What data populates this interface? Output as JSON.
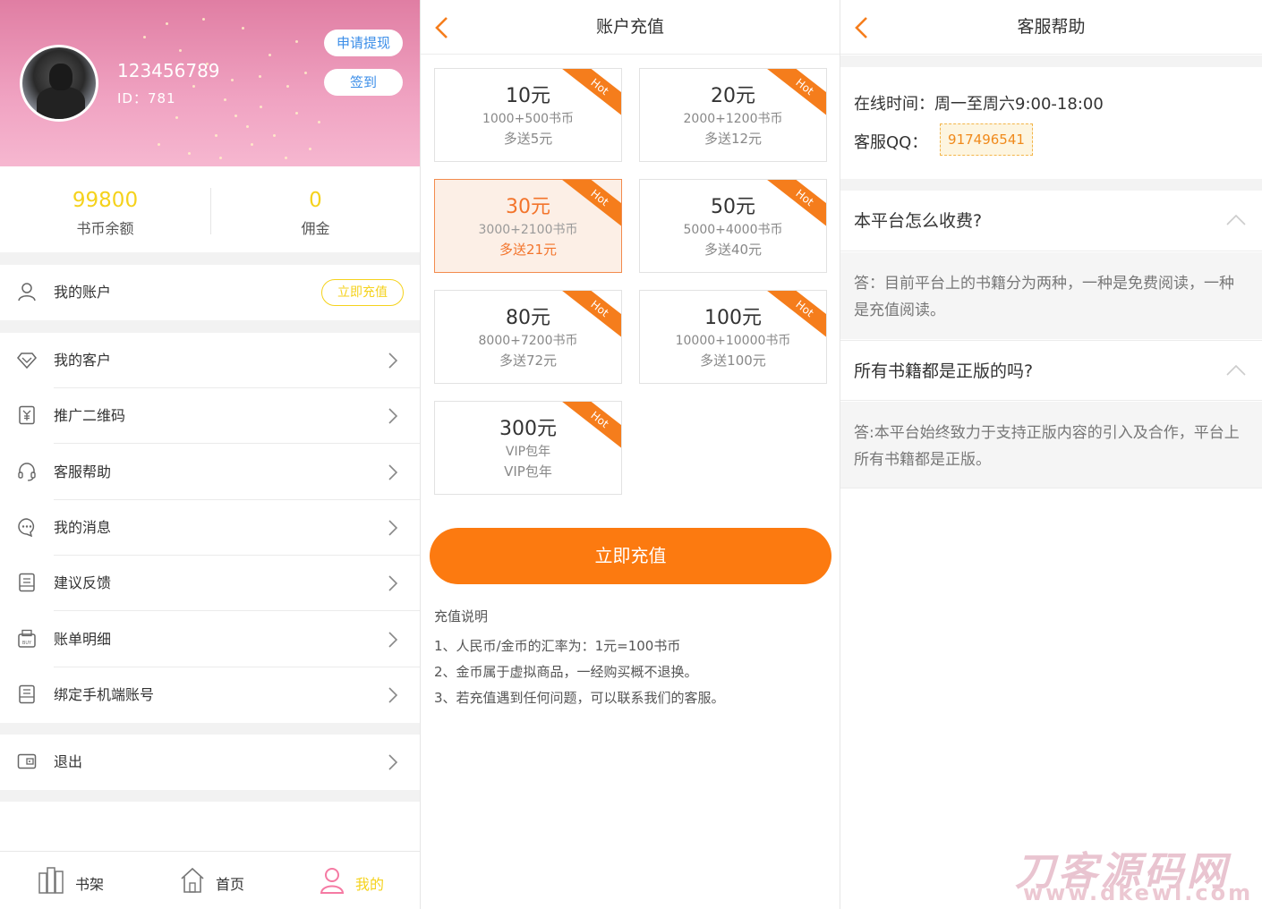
{
  "profile": {
    "username": "123456789",
    "id_text": "ID：781",
    "withdraw_label": "申请提现",
    "checkin_label": "签到",
    "balance_value": "99800",
    "balance_label": "书币余额",
    "commission_value": "0",
    "commission_label": "佣金",
    "accent_color": "#f5d21c",
    "hero_color": "#e07ea3"
  },
  "menu": {
    "account_label": "我的账户",
    "recharge_pill": "立即充值",
    "items": [
      {
        "label": "我的客户",
        "icon": "diamond-icon"
      },
      {
        "label": "推广二维码",
        "icon": "qr-yen-icon"
      },
      {
        "label": "客服帮助",
        "icon": "headset-icon"
      },
      {
        "label": "我的消息",
        "icon": "chat-bubble-icon"
      },
      {
        "label": "建议反馈",
        "icon": "feedback-icon"
      },
      {
        "label": "账单明细",
        "icon": "bill-icon"
      },
      {
        "label": "绑定手机端账号",
        "icon": "phone-bind-icon"
      }
    ],
    "logout_label": "退出"
  },
  "tabbar": {
    "bookshelf": "书架",
    "home": "首页",
    "mine": "我的"
  },
  "recharge": {
    "title": "账户充值",
    "hot_label": "Hot",
    "options": [
      {
        "amount": "10元",
        "coins": "1000+500书币",
        "bonus": "多送5元"
      },
      {
        "amount": "20元",
        "coins": "2000+1200书币",
        "bonus": "多送12元"
      },
      {
        "amount": "30元",
        "coins": "3000+2100书币",
        "bonus": "多送21元",
        "selected": true
      },
      {
        "amount": "50元",
        "coins": "5000+4000书币",
        "bonus": "多送40元"
      },
      {
        "amount": "80元",
        "coins": "8000+7200书币",
        "bonus": "多送72元"
      },
      {
        "amount": "100元",
        "coins": "10000+10000书币",
        "bonus": "多送100元"
      },
      {
        "amount": "300元",
        "coins": "VIP包年",
        "bonus": "VIP包年"
      }
    ],
    "button_label": "立即充值",
    "button_color": "#fc7a10",
    "notes_title": "充值说明",
    "notes": [
      "1、人民币/金币的汇率为：1元=100书币",
      "2、金币属于虚拟商品，一经购买概不退换。",
      "3、若充值遇到任何问题，可以联系我们的客服。"
    ]
  },
  "help": {
    "title": "客服帮助",
    "online_time": "在线时间：周一至周六9:00-18:00",
    "qq_label": "客服QQ：",
    "qq_value": "917496541",
    "faqs": [
      {
        "q": "本平台怎么收费?",
        "a": "答：目前平台上的书籍分为两种，一种是免费阅读，一种是充值阅读。"
      },
      {
        "q": "所有书籍都是正版的吗?",
        "a": "答:本平台始终致力于支持正版内容的引入及合作，平台上所有书籍都是正版。"
      }
    ],
    "watermark": "刀客源码网",
    "watermark_sub": "www.dkewl.com"
  }
}
